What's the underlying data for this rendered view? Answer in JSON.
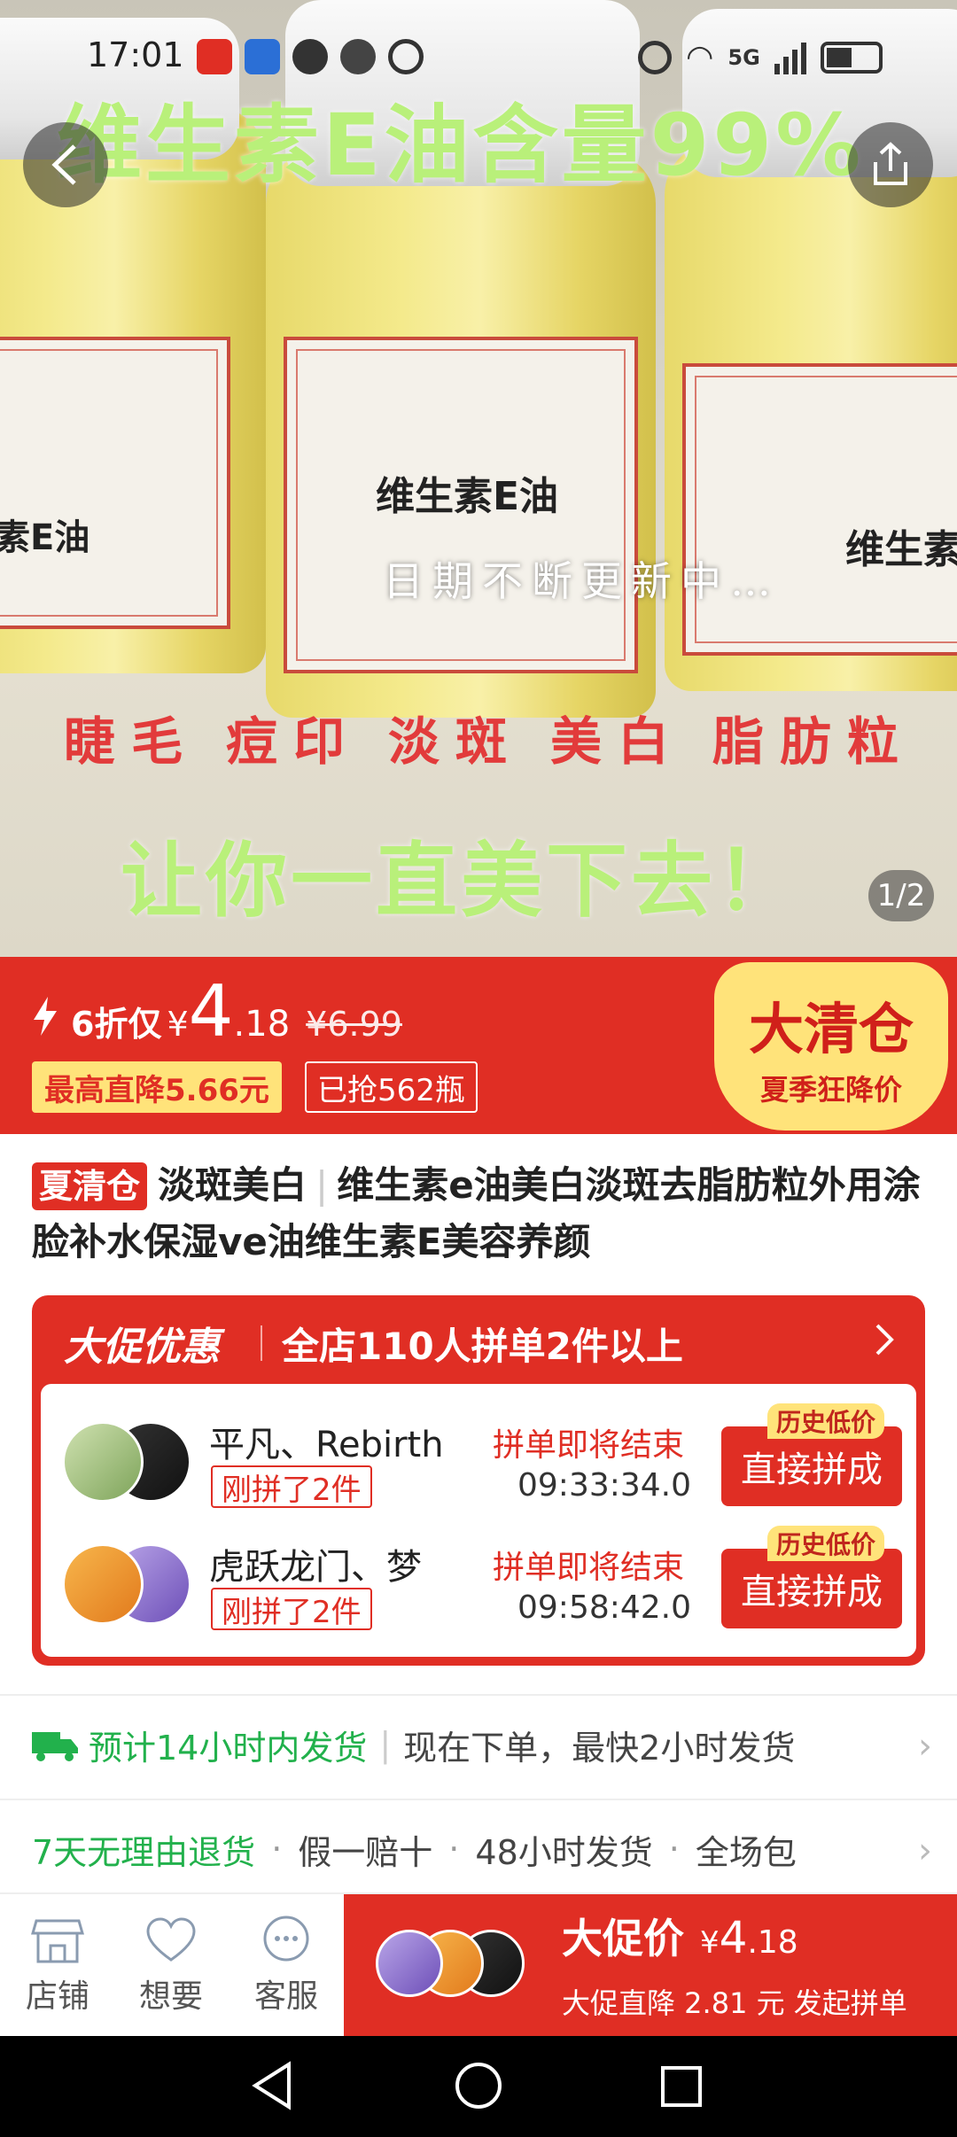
{
  "status_bar": {
    "time": "17:01",
    "network": "5G"
  },
  "hero": {
    "headline": "维生素E油含量99%",
    "bottle_label": "维生素E油",
    "bottle_label_right": "维生素",
    "bottle_label_left": "素E油",
    "update_note": "日期不断更新中…",
    "uses": [
      "睫毛",
      "痘印",
      "淡斑",
      "美白",
      "脂肪粒"
    ],
    "slogan": "让你一直美下去！",
    "page_indicator": "1/2"
  },
  "price": {
    "discount": "6折仅",
    "currency": "¥",
    "price_int": "4",
    "price_dec": ".18",
    "original": "¥6.99",
    "max_drop": "最高直降5.66元",
    "sold": "已抢562瓶",
    "clearance_title": "大清仓",
    "clearance_sub": "夏季狂降价"
  },
  "title": {
    "tag": "夏清仓",
    "part1": "淡斑美白",
    "part2": "维生素e油美白淡斑去脂肪粒外用涂脸补水保湿ve油维生素E美容养颜"
  },
  "promo": {
    "title": "大促优惠",
    "subtitle": "全店110人拼单2件以上",
    "groups": [
      {
        "names": "平凡、Rebirth",
        "status": "刚拼了2件",
        "ending": "拼单即将结束",
        "timer": "09:33:34.0",
        "low_tag": "历史低价",
        "button": "直接拼成"
      },
      {
        "names": "虎跃龙门、梦",
        "status": "刚拼了2件",
        "ending": "拼单即将结束",
        "timer": "09:58:42.0",
        "low_tag": "历史低价",
        "button": "直接拼成"
      }
    ]
  },
  "shipping": {
    "estimate": "预计14小时内发货",
    "detail": "现在下单，最快2小时发货"
  },
  "guarantees": {
    "first": "7天无理由退货",
    "items": [
      "假一赔十",
      "48小时发货",
      "全场包"
    ]
  },
  "bottom_bar": {
    "shop": "店铺",
    "want": "想要",
    "service": "客服",
    "cta_label": "大促价",
    "cta_currency": "¥",
    "cta_price_int": "4",
    "cta_price_dec": ".18",
    "cta_sub": "大促直降 2.81 元 发起拼单"
  },
  "colors": {
    "accent_red": "#e02e24",
    "highlight_yellow": "#ffe37a",
    "green": "#22b14c"
  }
}
